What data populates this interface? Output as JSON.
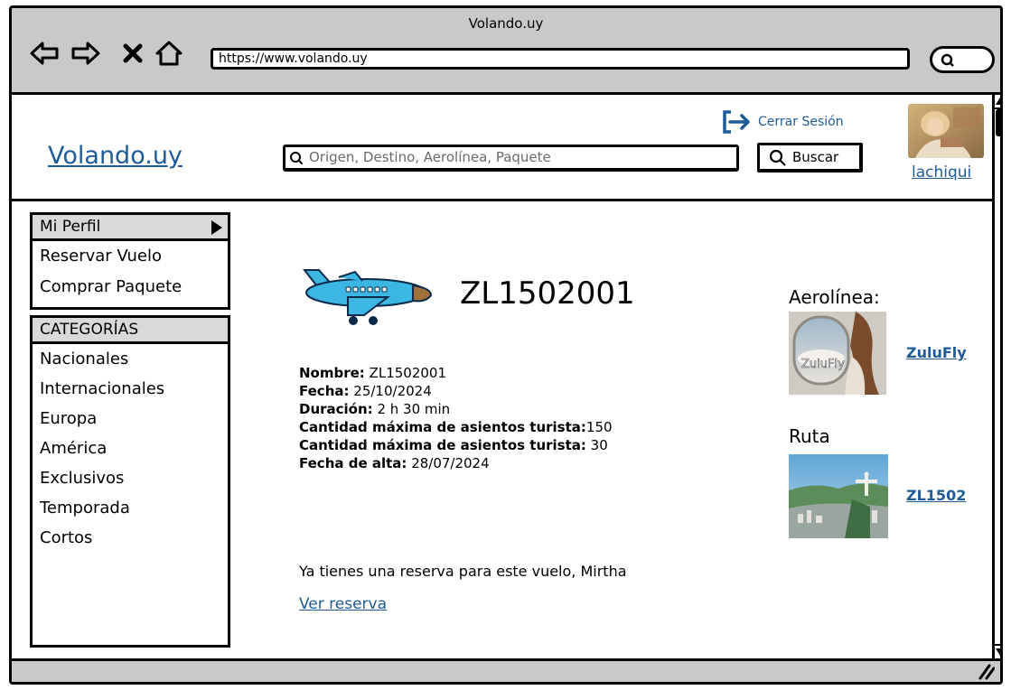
{
  "browser": {
    "title": "Volando.uy",
    "url": "https://www.volando.uy"
  },
  "header": {
    "logo": "Volando.uy",
    "search_placeholder": "Origen, Destino, Aerolínea, Paquete",
    "search_button": "Buscar",
    "logout": "Cerrar Sesión",
    "username": "lachiqui"
  },
  "sidebar": {
    "profile_items": [
      "Mi Perfil",
      "Reservar Vuelo",
      "Comprar Paquete"
    ],
    "categories_title": "CATEGORÍAS",
    "categories": [
      "Nacionales",
      "Internacionales",
      "Europa",
      "América",
      "Exclusivos",
      "Temporada",
      "Cortos"
    ]
  },
  "flight": {
    "code": "ZL1502001",
    "details": [
      {
        "label": "Nombre:",
        "value": " ZL1502001"
      },
      {
        "label": "Fecha:",
        "value": " 25/10/2024"
      },
      {
        "label": "Duración:",
        "value": " 2 h 30 min"
      },
      {
        "label": "Cantidad máxima de asientos turista:",
        "value": "150"
      },
      {
        "label": "Cantidad máxima de asientos turista:",
        "value": " 30"
      },
      {
        "label": "Fecha de alta:",
        "value": " 28/07/2024"
      }
    ],
    "notice": "Ya tienes una reserva para este vuelo, Mirtha",
    "view_reservation": "Ver reserva"
  },
  "aside": {
    "airline_heading": "Aerolínea:",
    "airline_name": "ZuluFly",
    "airline_logo_text": "ZuluFly",
    "route_heading": "Ruta",
    "route_name": "ZL1502"
  },
  "colors": {
    "link": "#1f5b99",
    "chrome": "#c9c9c9",
    "plane_body": "#3cb6e3"
  }
}
